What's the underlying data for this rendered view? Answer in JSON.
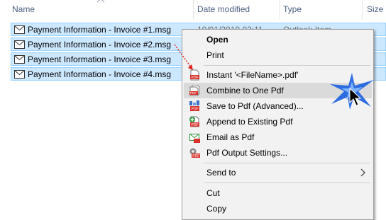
{
  "columns": {
    "name": "Name",
    "date_modified": "Date modified",
    "type": "Type",
    "size": "Size"
  },
  "files": [
    {
      "name": "Payment Information - Invoice #1.msg",
      "date": "10/01/2019 03:11",
      "type": "Outlook Item"
    },
    {
      "name": "Payment Information - Invoice #2.msg",
      "date": "",
      "type": ""
    },
    {
      "name": "Payment Information - Invoice #3.msg",
      "date": "",
      "type": ""
    },
    {
      "name": "Payment Information - Invoice #4.msg",
      "date": "",
      "type": ""
    }
  ],
  "context_menu": {
    "open": "Open",
    "print": "Print",
    "instant": "Instant '<FileName>.pdf'",
    "combine": "Combine to One Pdf",
    "save_advanced": "Save to Pdf (Advanced)...",
    "append": "Append to Existing Pdf",
    "email": "Email as Pdf",
    "settings": "Pdf Output Settings...",
    "send_to": "Send to",
    "cut": "Cut",
    "copy": "Copy"
  },
  "colors": {
    "selection": "#cce8ff",
    "selection_border": "#99d1ff",
    "menu_background": "#f2f2f2",
    "menu_hover": "#dadada",
    "pdf_red": "#d9322b",
    "annotation_red": "#e02020",
    "spark_blue": "#1a5fe0"
  },
  "icons": {
    "file_icon": "envelope-icon",
    "pdf_icon": "pdf-icon",
    "submenu": "chevron-right-icon"
  }
}
